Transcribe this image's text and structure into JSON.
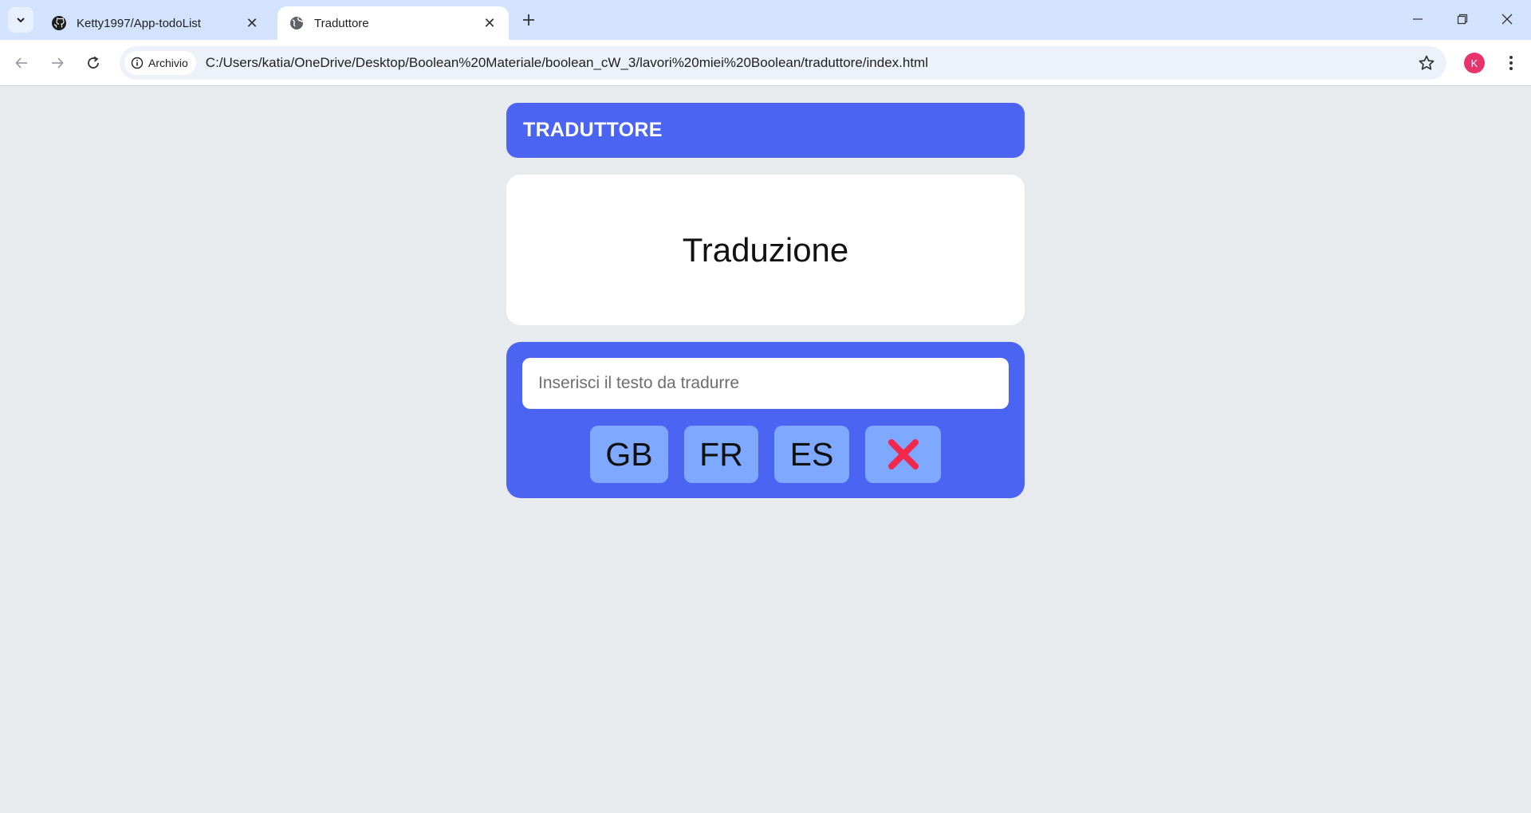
{
  "browser": {
    "tabs": [
      {
        "title": "Ketty1997/App-todoList",
        "icon": "github-icon",
        "active": false
      },
      {
        "title": "Traduttore",
        "icon": "globe-icon",
        "active": true
      }
    ],
    "site_chip": "Archivio",
    "url": "C:/Users/katia/OneDrive/Desktop/Boolean%20Materiale/boolean_cW_3/lavori%20miei%20Boolean/traduttore/index.html",
    "profile_initial": "K",
    "profile_color": "#e8336d"
  },
  "app": {
    "header_title": "TRADUTTORE",
    "output_text": "Traduzione",
    "input_placeholder": "Inserisci il testo da tradurre",
    "input_value": "",
    "buttons": [
      {
        "label": "GB"
      },
      {
        "label": "FR"
      },
      {
        "label": "ES"
      },
      {
        "label": "❌",
        "icon": "cross-mark-icon"
      }
    ]
  },
  "colors": {
    "accent": "#4b65f2",
    "button_bg": "#7ea9ff",
    "page_bg": "#e8ebee",
    "clear_icon": "#f2284d"
  }
}
